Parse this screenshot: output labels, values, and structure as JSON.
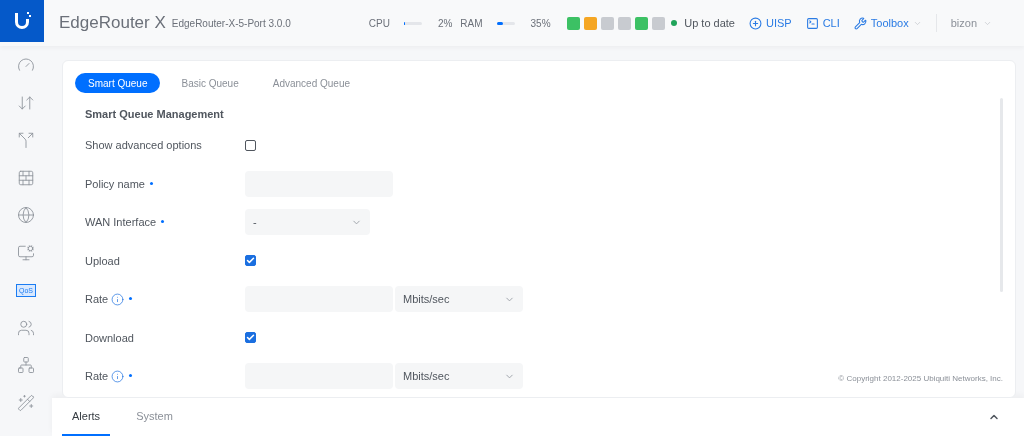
{
  "header": {
    "product": "EdgeRouter X",
    "model": "EdgeRouter-X-5-Port 3.0.0",
    "meters": [
      {
        "label": "CPU",
        "level": 0.02,
        "reading": "2%"
      },
      {
        "label": "RAM",
        "level": 0.35,
        "reading": "35%"
      }
    ],
    "ports": [
      {
        "color": "#3cc164"
      },
      {
        "color": "#f5a623"
      },
      {
        "color": "#c8cbd0"
      },
      {
        "color": "#c8cbd0"
      },
      {
        "color": "#3cc164"
      },
      {
        "color": "#c8cbd0"
      }
    ],
    "status": "Up to date",
    "actions": [
      {
        "kind": "uisp",
        "label": "UISP"
      },
      {
        "kind": "cli",
        "label": "CLI"
      },
      {
        "kind": "toolbox",
        "label": "Toolbox"
      }
    ],
    "user": "bizon"
  },
  "sidebar": {
    "items": [
      {
        "kind": "dashboard",
        "selected": false
      },
      {
        "kind": "routing",
        "selected": false
      },
      {
        "kind": "network",
        "selected": false
      },
      {
        "kind": "firewall",
        "selected": false
      },
      {
        "kind": "services",
        "selected": false
      },
      {
        "kind": "vpn",
        "selected": false
      },
      {
        "kind": "qos",
        "label": "QoS",
        "selected": true
      },
      {
        "kind": "users",
        "selected": false
      },
      {
        "kind": "wizard-tree",
        "selected": false
      },
      {
        "kind": "wizard",
        "selected": false
      }
    ]
  },
  "tabs": [
    {
      "label": "Smart Queue",
      "selected": true
    },
    {
      "label": "Basic Queue",
      "selected": false
    },
    {
      "label": "Advanced Queue",
      "selected": false
    }
  ],
  "section_title": "Smart Queue Management",
  "form": [
    {
      "kind": "checkbox",
      "label": "Show advanced options",
      "checked": false
    },
    {
      "kind": "text",
      "label": "Policy name",
      "required": true
    },
    {
      "kind": "select",
      "label": "WAN Interface",
      "required": true,
      "value": "-"
    },
    {
      "kind": "checkbox",
      "label": "Upload",
      "checked": true
    },
    {
      "kind": "rate",
      "label": "Rate",
      "info": true,
      "required": true,
      "unit": "Mbits/sec"
    },
    {
      "kind": "checkbox",
      "label": "Download",
      "checked": true
    },
    {
      "kind": "rate",
      "label": "Rate",
      "info": true,
      "required": true,
      "unit": "Mbits/sec"
    }
  ],
  "copyright": "© Copyright 2012-2025 Ubiquiti Networks, Inc.",
  "bottom_tabs": [
    {
      "label": "Alerts",
      "selected": true
    },
    {
      "label": "System",
      "selected": false
    }
  ]
}
